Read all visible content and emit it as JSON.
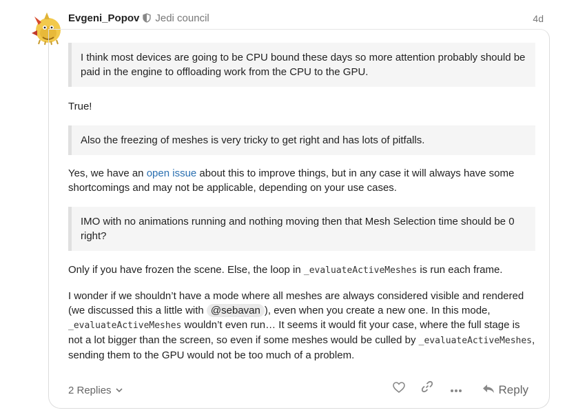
{
  "post": {
    "username": "Evgeni_Popov",
    "group": "Jedi council",
    "date": "4d"
  },
  "content": {
    "quote1": "I think most devices are going to be CPU bound these days so more attention probably should be paid in the engine to offloading work from the CPU to the GPU.",
    "reply1": "True!",
    "quote2": "Also the freezing of meshes is very tricky to get right and has lots of pitfalls.",
    "reply2_pre": "Yes, we have an ",
    "reply2_link": "open issue",
    "reply2_post": " about this to improve things, but in any case it will always have some shortcomings and may not be applicable, depending on your use cases.",
    "quote3": "IMO with no animations running and nothing moving then that Mesh Selection time should be 0 right?",
    "reply3_pre": "Only if you have frozen the scene. Else, the loop in ",
    "reply3_code": "_evaluateActiveMeshes",
    "reply3_post": " is run each frame.",
    "reply4_a": "I wonder if we shouldn’t have a mode where all meshes are always considered visible and rendered (we discussed this a little with ",
    "reply4_mention": "@sebavan",
    "reply4_b": "), even when you create a new one. In this mode, ",
    "reply4_code1": "_evaluateActiveMeshes",
    "reply4_c": " wouldn’t even run… It seems it would fit your case, where the full stage is not a lot bigger than the screen, so even if some meshes would be culled by ",
    "reply4_code2": "_evaluateActiveMeshes",
    "reply4_d": ", sending them to the GPU would not be too much of a problem."
  },
  "footer": {
    "replies_label": "2 Replies",
    "reply_label": "Reply"
  },
  "icons": {
    "like": "heart-icon",
    "link": "link-icon",
    "more": "more-icon",
    "reply": "reply-arrow-icon"
  },
  "colors": {
    "link": "#2a6fb0",
    "muted": "#777777",
    "quote_bg": "#f5f5f5"
  }
}
